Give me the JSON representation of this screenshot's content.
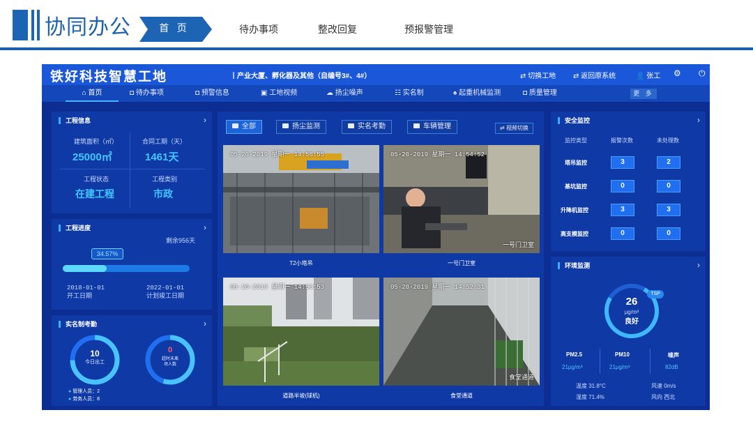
{
  "slide": {
    "title": "协同办公",
    "nav": [
      {
        "label": "首 页",
        "active": true
      },
      {
        "label": "待办事项"
      },
      {
        "label": "整改回复"
      },
      {
        "label": "预报警管理"
      }
    ],
    "colors": {
      "accent": "#1d64b4",
      "header_line": "#1a5fa8"
    }
  },
  "dashboard": {
    "title": "铁好科技智慧工地",
    "subtitle": "丨产业大厦、孵化器及其他（自编号3#、4#）",
    "top_right": {
      "switch_site": "切换工地",
      "return_system": "返回原系统",
      "user": "张工",
      "icons": [
        "user-icon",
        "gear-icon",
        "power-icon"
      ]
    },
    "nav": [
      "首页",
      "待办事项",
      "预警信息",
      "工地视频",
      "扬尘噪声",
      "实名制",
      "起重机械监测",
      "质量管理"
    ],
    "nav_more": "更 多",
    "project_info": {
      "title": "工程信息",
      "area_label": "建筑面积（㎡）",
      "area_value": "25000㎡",
      "period_label": "合同工期（天）",
      "period_value": "1461天",
      "status_label": "工程状态",
      "status_value": "在建工程",
      "category_label": "工程类别",
      "category_value": "市政"
    },
    "progress": {
      "title": "工程进度",
      "remaining": "剩余956天",
      "percent_label": "34.57%",
      "percent": 34.57,
      "start_date": "2018-01-01",
      "start_label": "开工日期",
      "end_date": "2022-01-01",
      "end_label": "计划竣工日期"
    },
    "attendance": {
      "title": "实名制考勤",
      "today_value": "10",
      "today_label": "今日出工",
      "overtime_value": "0",
      "overtime_label1": "超时未离",
      "overtime_label2": "场人数",
      "managers": "管理人员：2",
      "workers": "劳务人员：8"
    },
    "video": {
      "tabs": [
        "全部",
        "扬尘监测",
        "实名考勤",
        "车辆管理"
      ],
      "switch_view": "视频切换",
      "feeds": [
        {
          "stamp": "05-20-2019 星期一 14:56:55",
          "caption": "T2小塔吊",
          "corner": ""
        },
        {
          "stamp": "05-20-2019 星期一 14:54:52",
          "caption": "一号门卫室",
          "corner": "一号门卫室"
        },
        {
          "stamp": "05-20-2019 星期一 14:56:53",
          "caption": "道路半坡(球机)",
          "corner": ""
        },
        {
          "stamp": "05-20-2019 星期一 14:52:31",
          "caption": "食堂通道",
          "corner": "食堂通道"
        }
      ]
    },
    "safety": {
      "title": "安全监控",
      "headers": [
        "监控类型",
        "报警次数",
        "未处理数"
      ],
      "rows": [
        {
          "type": "塔吊监控",
          "alarms": "3",
          "unhandled": "2"
        },
        {
          "type": "基坑监控",
          "alarms": "0",
          "unhandled": "0"
        },
        {
          "type": "升降机监控",
          "alarms": "3",
          "unhandled": "3"
        },
        {
          "type": "高支模监控",
          "alarms": "0",
          "unhandled": "0"
        }
      ]
    },
    "environment": {
      "title": "环境监测",
      "tsp_value": "26",
      "tsp_tag": "TSP",
      "tsp_unit": "μg/m³",
      "tsp_status": "良好",
      "pm25_label": "PM2.5",
      "pm25_value": "21μg/m³",
      "pm10_label": "PM10",
      "pm10_value": "21μg/m³",
      "noise_label": "噪声",
      "noise_value": "82dB",
      "temperature": "温度 31.8°C",
      "wind_speed": "风速 0m/s",
      "humidity": "湿度 71.4%",
      "wind_dir": "风向 西北"
    },
    "colors": {
      "background": "#0c2d91",
      "panel": "#0f3aa6",
      "topbar": "#1b57d9",
      "cyan": "#41c6ff"
    }
  }
}
